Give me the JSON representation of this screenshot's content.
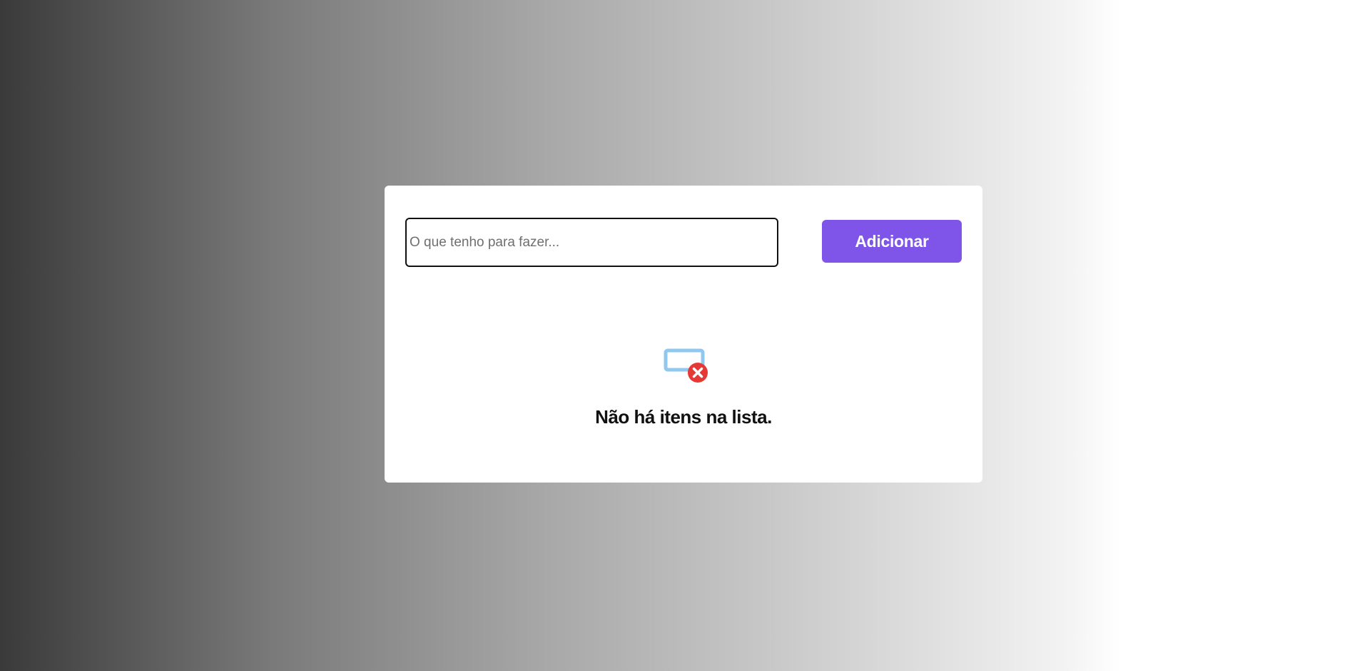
{
  "todo": {
    "input_placeholder": "O que tenho para fazer...",
    "input_value": "",
    "add_button_label": "Adicionar",
    "empty_message": "Não há itens na lista."
  },
  "icons": {
    "empty_list": "empty-list-icon"
  },
  "colors": {
    "accent": "#7f54e8",
    "icon_blue": "#90c8f0",
    "icon_red": "#e53935",
    "card_bg": "#ffffff"
  }
}
